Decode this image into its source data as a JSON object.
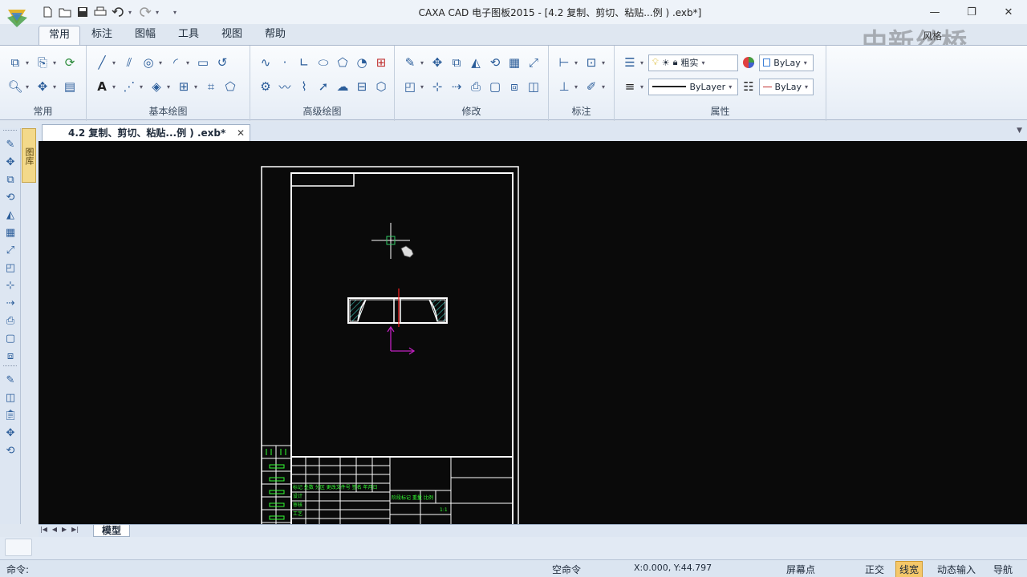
{
  "app": {
    "title": "CAXA CAD 电子图板2015 - [4.2 复制、剪切、粘贴...例 ) .exb*]"
  },
  "qat_icons": [
    "new-file-icon",
    "open-folder-icon",
    "save-icon",
    "print-icon",
    "undo-icon",
    "redo-icon",
    "customize-qat-icon"
  ],
  "window_controls": {
    "minimize": "—",
    "restore": "❐",
    "close": "✕"
  },
  "ribbon_tabs": [
    "常用",
    "标注",
    "图幅",
    "工具",
    "视图",
    "帮助"
  ],
  "active_tab": "常用",
  "style_button": "风格",
  "watermark": "中新丝桥",
  "help_label": "?",
  "groups": {
    "common": "常用",
    "basic_draw": "基本绘图",
    "advanced_draw": "高级绘图",
    "modify": "修改",
    "annotate": "标注",
    "properties": "属性"
  },
  "properties": {
    "layer_combo": "粗实",
    "color_combo": "ByLay",
    "linetype_combo": "ByLayer",
    "linewidth_combo": "ByLay"
  },
  "side_panel_label": "图库",
  "document_tab": "4.2 复制、剪切、粘贴...例 ) .exb*",
  "sheet_tab": "模型",
  "title_block_text": {
    "r1": "标记 处数 分区 更改文件号 签名 年月日",
    "r2": "设计",
    "r3": "审核",
    "r4": "工艺",
    "r5": "阶段标记 重量 比例",
    "scale": "1:1"
  },
  "status": {
    "command_label": "命令:",
    "command_state": "空命令",
    "coordinates": "X:0.000, Y:44.797",
    "snap_mode": "屏幕点",
    "ortho": "正交",
    "lineweight": "线宽",
    "dynamic_input": "动态输入",
    "navigation": "导航"
  },
  "colors": {
    "canvas_bg": "#0a0a0a",
    "frame": "#ffffff",
    "title_block_text": "#33ff33",
    "crosshair_box": "#33cc66",
    "axis": "#c020c0",
    "center_line": "#ff2020",
    "hatch": "#40e0d0"
  }
}
